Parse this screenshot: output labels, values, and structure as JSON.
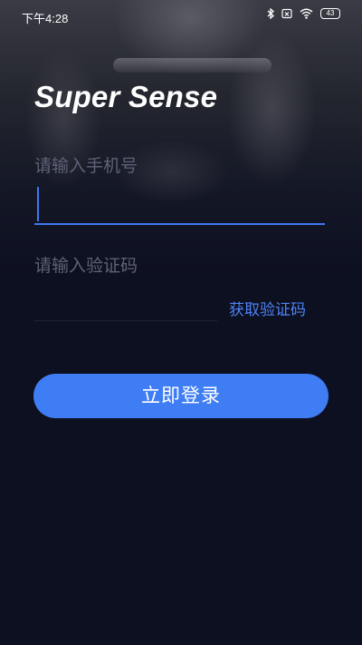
{
  "status_bar": {
    "time": "下午4:28",
    "battery": "43",
    "icons": [
      "bluetooth-icon",
      "no-sim-icon",
      "wifi-icon",
      "battery-icon"
    ]
  },
  "brand": {
    "title": "Super Sense"
  },
  "login_form": {
    "phone": {
      "label": "请输入手机号",
      "value": ""
    },
    "code": {
      "label": "请输入验证码",
      "value": ""
    },
    "get_code_label": "获取验证码",
    "submit_label": "立即登录"
  },
  "colors": {
    "background": "#0d1020",
    "accent": "#3f7df5",
    "label": "#5e6276",
    "link": "#4d82f5"
  }
}
